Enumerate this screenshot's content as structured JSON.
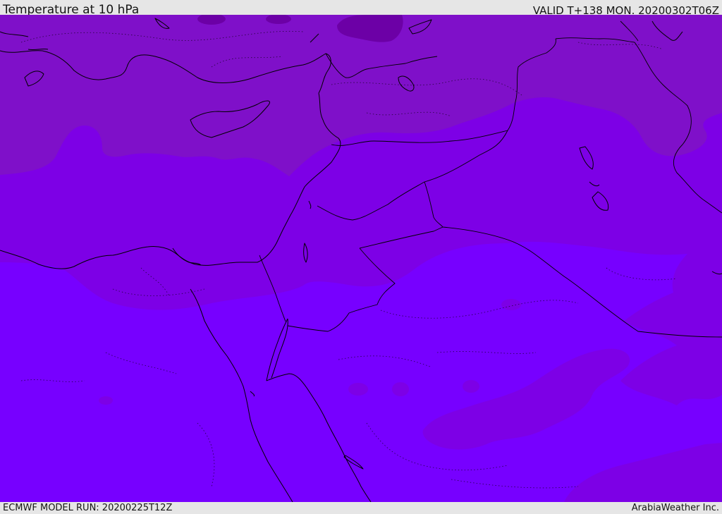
{
  "header": {
    "title": "Temperature at 10 hPa",
    "valid": "VALID T+138 MON. 20200302T06Z"
  },
  "footer": {
    "model_run": "ECMWF MODEL RUN: 20200225T12Z",
    "credit": "ArabiaWeather Inc."
  },
  "colors": {
    "band_warmest": "#7700ff",
    "band_mid": "#7d00e6",
    "band_cool": "#7f10c9",
    "band_coldest": "#6c00a6",
    "coastline": "#000000",
    "border": "#000000"
  },
  "map": {
    "field": "temperature",
    "level": "10 hPa",
    "region": "Eastern Mediterranean / Middle East"
  }
}
